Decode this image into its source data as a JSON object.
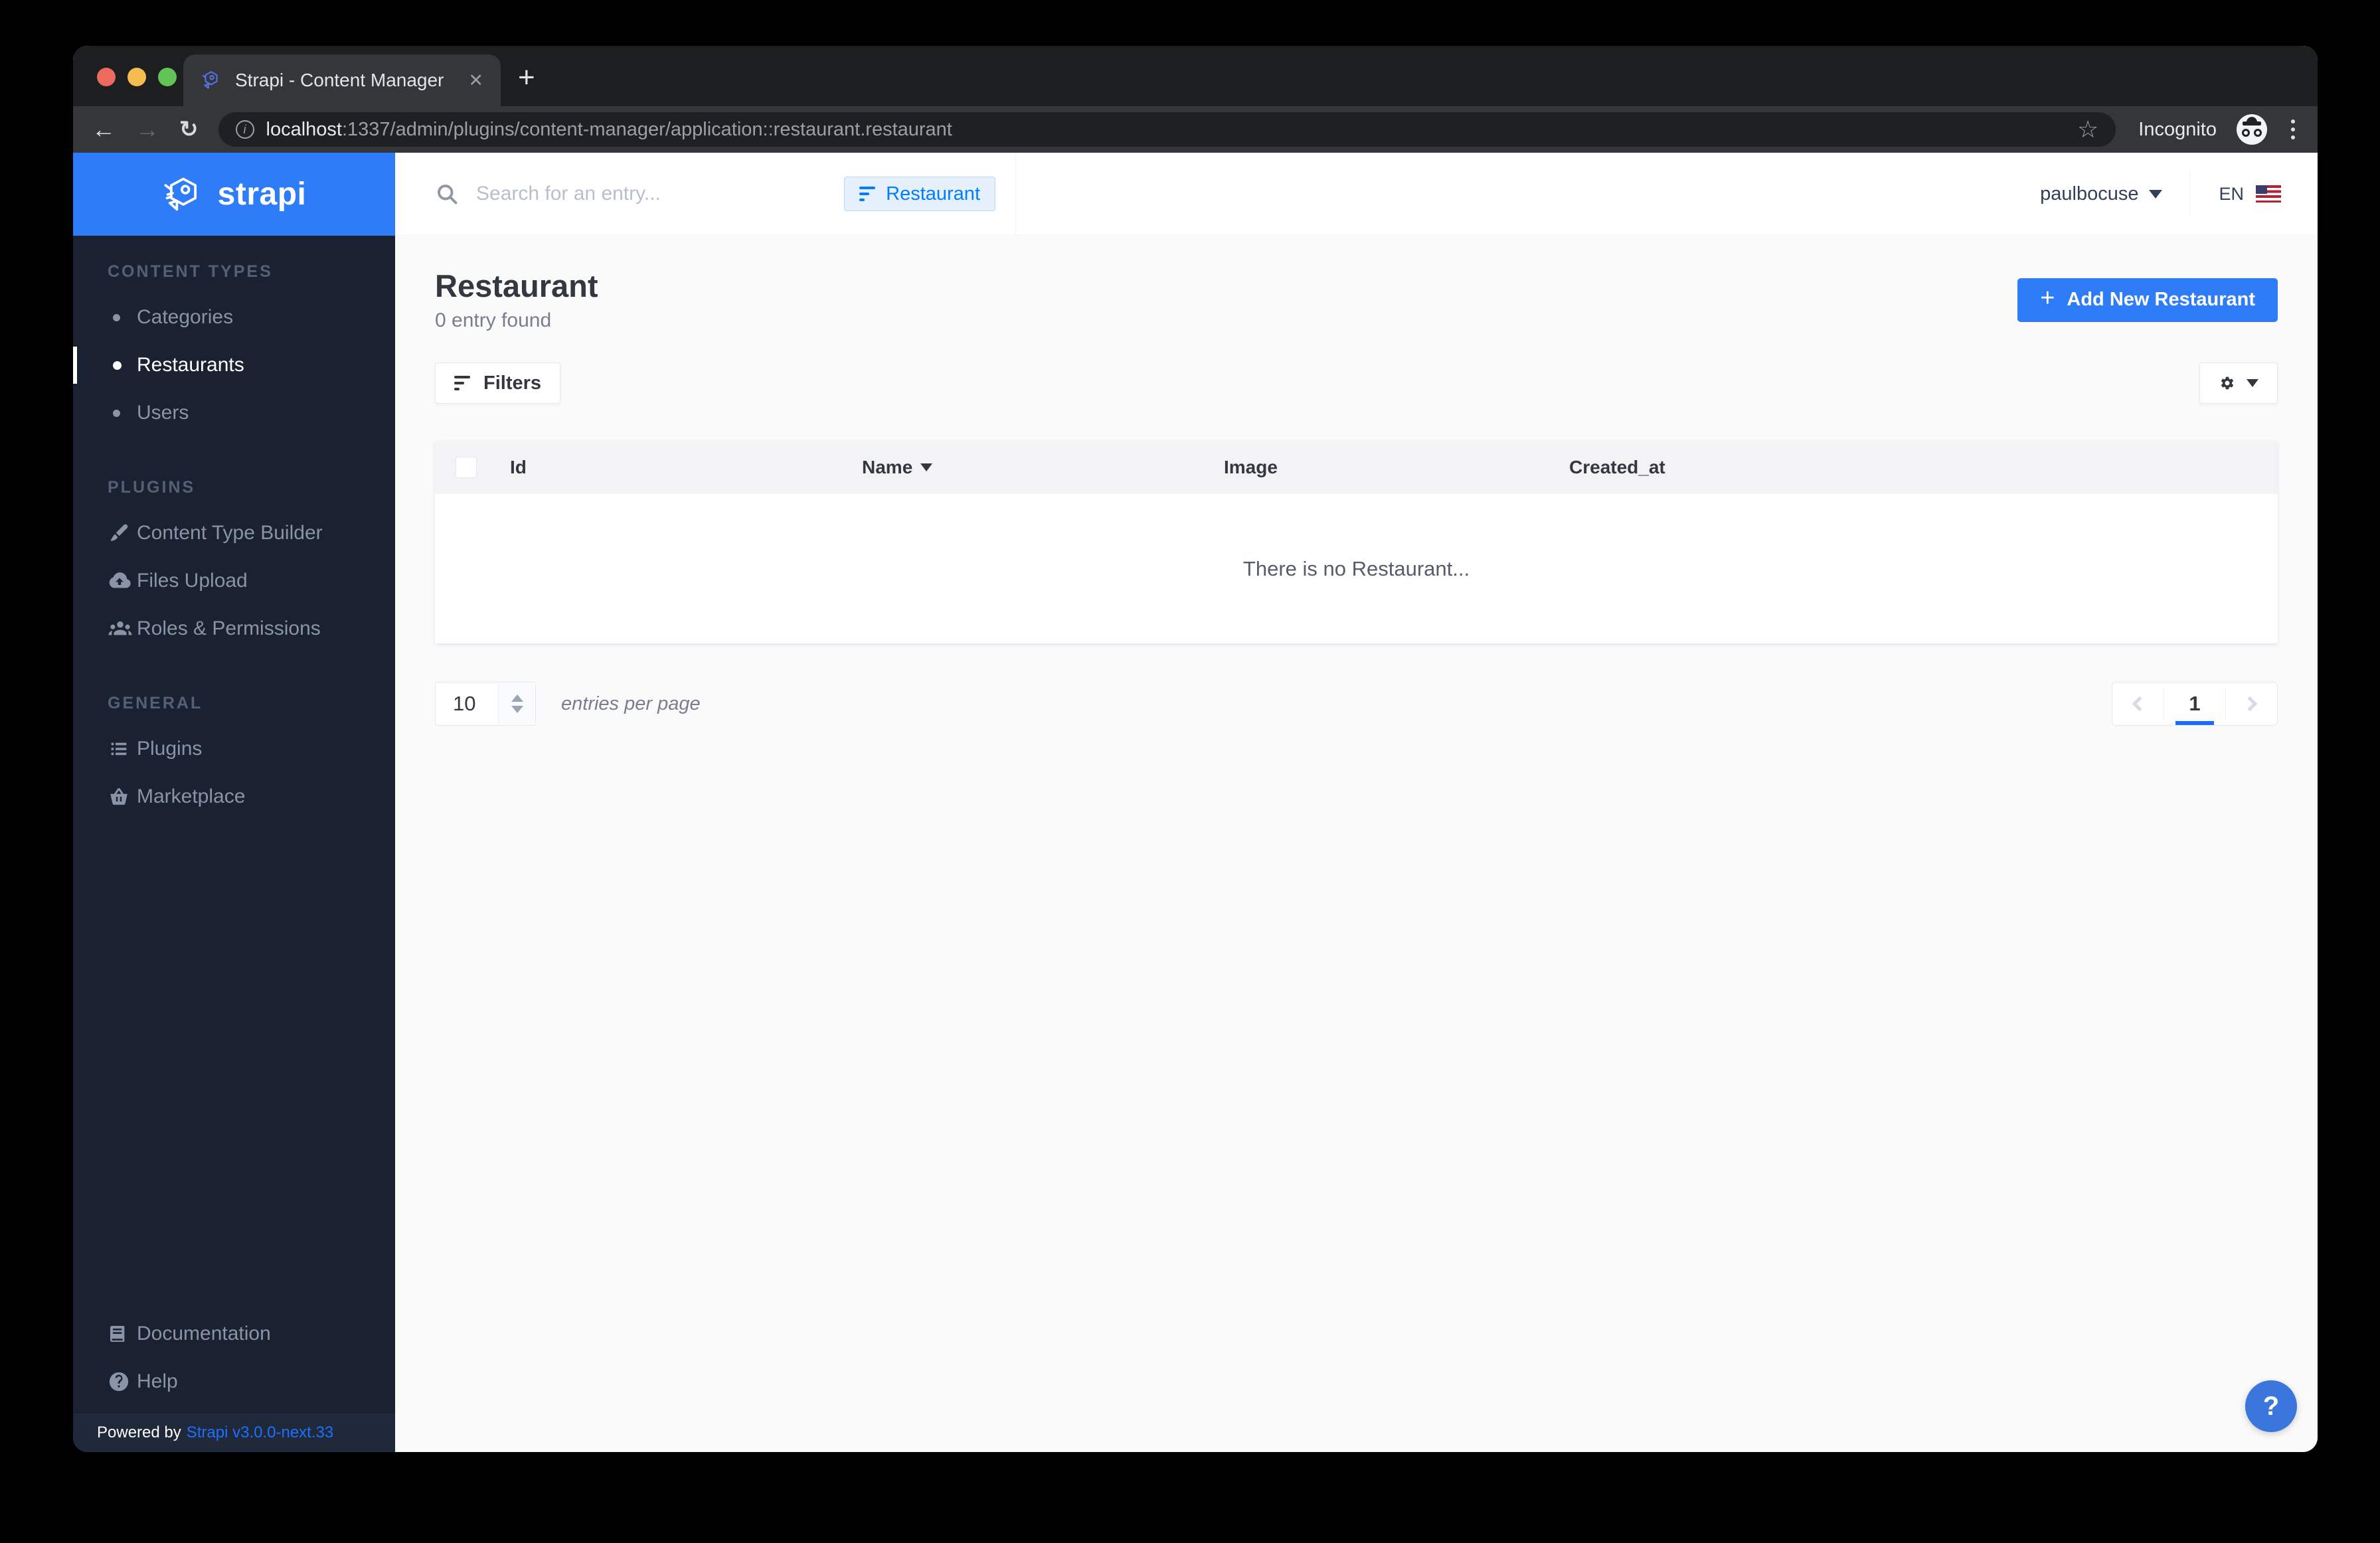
{
  "browser": {
    "tab_title": "Strapi - Content Manager",
    "url_host": "localhost",
    "url_rest": ":1337/admin/plugins/content-manager/application::restaurant.restaurant",
    "incognito_label": "Incognito"
  },
  "icons": {
    "back_arrow": "←",
    "forward_arrow": "→",
    "reload": "↻",
    "info": "i",
    "star": "☆",
    "close_tab": "✕",
    "new_tab": "+",
    "plus": "+",
    "question": "?",
    "search": "magnifier-css-shape",
    "filter": "three-bars-css-shape",
    "gear": "gear-svg-shape"
  },
  "sidebar": {
    "brand": "strapi",
    "sections": [
      {
        "label": "CONTENT TYPES",
        "items": [
          {
            "label": "Categories"
          },
          {
            "label": "Restaurants",
            "active": true
          },
          {
            "label": "Users"
          }
        ]
      },
      {
        "label": "PLUGINS",
        "items": [
          {
            "label": "Content Type Builder"
          },
          {
            "label": "Files Upload"
          },
          {
            "label": "Roles & Permissions"
          }
        ]
      },
      {
        "label": "GENERAL",
        "items": [
          {
            "label": "Plugins"
          },
          {
            "label": "Marketplace"
          }
        ]
      }
    ],
    "footer_links": [
      {
        "label": "Documentation"
      },
      {
        "label": "Help"
      }
    ],
    "powered_by": "Powered by",
    "version": "Strapi v3.0.0-next.33"
  },
  "header": {
    "search_placeholder": "Search for an entry...",
    "filter_chip": "Restaurant",
    "user_name": "paulbocuse",
    "locale": "EN"
  },
  "page": {
    "title": "Restaurant",
    "subtitle": "0 entry found",
    "add_button": "Add New Restaurant",
    "filters_button": "Filters",
    "table": {
      "columns": [
        "Id",
        "Name",
        "Image",
        "Created_at"
      ],
      "empty_message": "There is no Restaurant..."
    },
    "pagination": {
      "per_page": "10",
      "per_page_label": "entries per page",
      "current_page": "1"
    }
  },
  "colors": {
    "brand_blue": "#2e7cf7",
    "link_blue": "#007eff",
    "underline_blue": "#1c6aff",
    "sidebar_bg": "#1a2232",
    "chip_bg": "#e5f0fc"
  }
}
